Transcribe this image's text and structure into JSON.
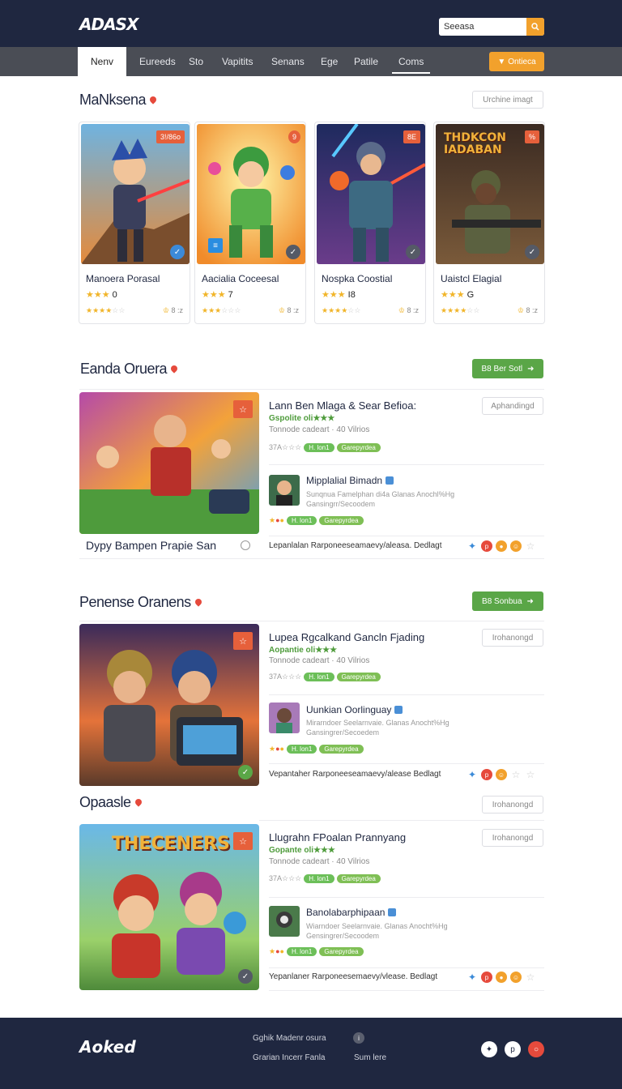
{
  "header": {
    "logo": "ADASX",
    "search_value": "Seeasa",
    "nav_tabs": [
      "Nenv",
      "Eureeds",
      "Sto",
      "Vapitits",
      "Senans",
      "Ege",
      "Patile",
      "Coms"
    ],
    "nav_cta": "Ontieca"
  },
  "section1": {
    "title": "MaNksena",
    "action": "Urchine imagt",
    "cards": [
      {
        "name": "Manoera Porasal",
        "rating": "0",
        "meta": "8 :z",
        "tag": "3!/86o"
      },
      {
        "name": "Aacialia Coceesal",
        "rating": "7",
        "meta": "8 :z",
        "tag": "9"
      },
      {
        "name": "Nospka Coostial",
        "rating": "I8",
        "meta": "8 :z",
        "tag": "8E"
      },
      {
        "name": "Uaistcl Elagial",
        "rating": "G",
        "meta": "8 :z",
        "tag": "%",
        "art_text": "THDKCON IADABAN"
      }
    ]
  },
  "section2": {
    "title": "Eanda Oruera",
    "action": "B8 Ber Sotl",
    "caption": "Dypy Bampen Prapie San",
    "main_title": "Lann Ben Mlaga & Sear Befioa:",
    "main_green": "Gspolite oli★★★",
    "main_sub": "Tonnode cadeart · 40 Vilrios",
    "main_line": "37A☆☆☆",
    "pill1": "H. lon1",
    "pill2": "Garepyrdea",
    "ghost": "Aphandingd",
    "sub_title": "Mipplalial Bimadn",
    "sub_desc1": "Sunqnua Famelphan di4a Glanas Anochl%Hg",
    "sub_desc2": "Gansingrr/Secoodem",
    "bottom": "Lepanlalan Rarponeeseamaevy/aleasa. Dedlagt"
  },
  "section3": {
    "title": "Penense Oranens",
    "action": "B8 Sonbua",
    "main_title": "Lupea Rgcalkand Gancln Fjading",
    "main_green": "Aopantie oli★★★",
    "main_sub": "Tonnode cadeart · 40 Vilrios",
    "main_line": "37A☆☆☆",
    "pill1": "H. lon1",
    "pill2": "Garepyrdea",
    "ghost": "Irohanongd",
    "sub_title": "Uunkian Oorlinguay",
    "sub_desc1": "Mirarndoer Seelarnvaie. Glanas Anocht%Hg",
    "sub_desc2": "Gansingrer/Secoedem",
    "bottom": "Vepantaher Rarponeeseamaevy/alease Bedlagt"
  },
  "section4": {
    "title": "Opaasle",
    "action": "Irohanongd",
    "art_text": "THECENERS",
    "main_title": "Llugrahn FPoalan Prannyang",
    "main_green": "Gopante oli★★★",
    "main_sub": "Tonnode cadeart · 40 Vilrios",
    "main_line": "37A☆☆☆",
    "pill1": "H. lon1",
    "pill2": "Garepyrdea",
    "ghost": "Irohanongd",
    "sub_title": "Banolabarphipaan",
    "sub_desc1": "Wiarndoer Seelarnvaie. Glanas Anocht%Hg",
    "sub_desc2": "Gensingrer/Secoodem",
    "bottom": "Yepanlaner Rarponeesemaevy/vlease. Bedlagt"
  },
  "footer": {
    "logo": "Aoked",
    "link1": "Gghik Madenr osura",
    "link2": "Grarian Incerr Fanla",
    "link3": "Sum lere"
  },
  "colors": {
    "navy": "#1f2740",
    "nav_gray": "#4a4d55",
    "orange": "#f2a12c",
    "green": "#5aa647",
    "red": "#e6603b"
  }
}
